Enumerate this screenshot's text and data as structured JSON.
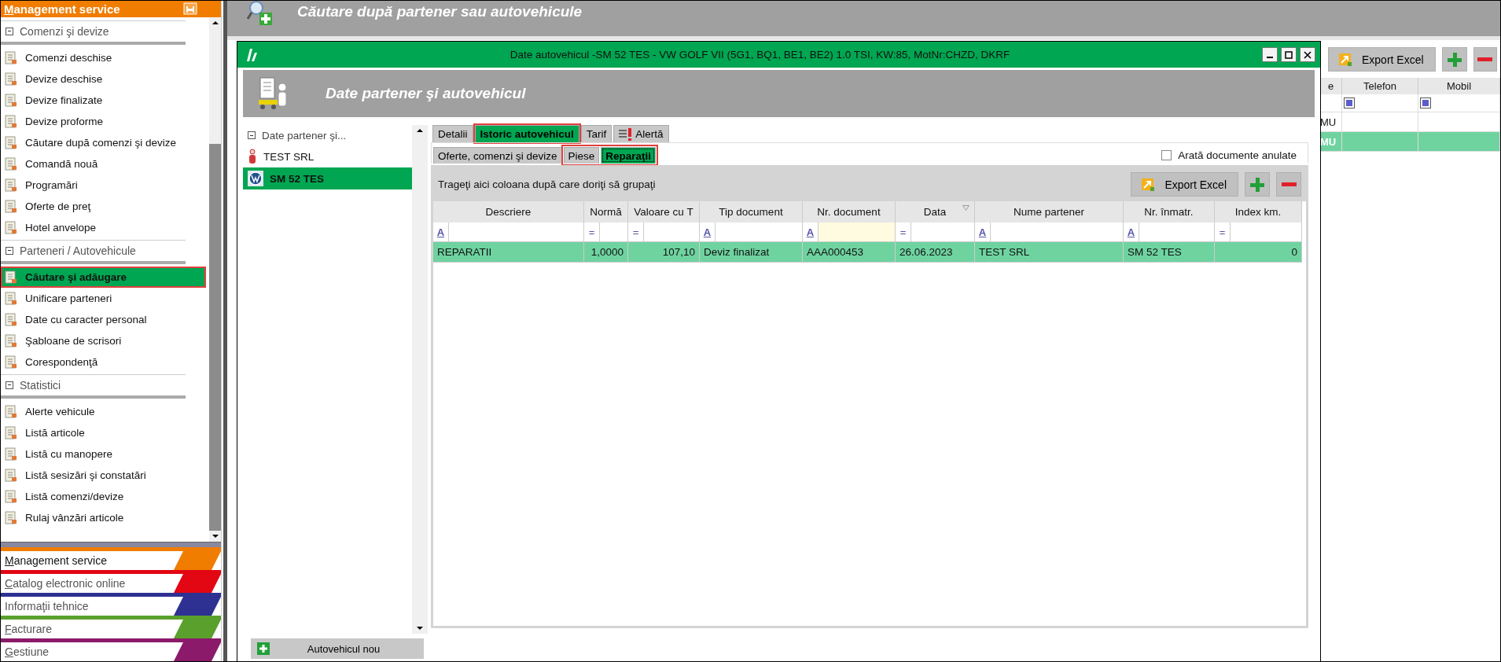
{
  "sidebar": {
    "header": {
      "label": "Management service",
      "underline_first": true
    },
    "sections": [
      {
        "title": "Comenzi şi devize",
        "expanded": true,
        "items": [
          {
            "label": "Comenzi deschise",
            "selected": false,
            "annotated": false
          },
          {
            "label": "Devize deschise",
            "selected": false,
            "annotated": false
          },
          {
            "label": "Devize finalizate",
            "selected": false,
            "annotated": false
          },
          {
            "label": "Devize proforme",
            "selected": false,
            "annotated": false
          },
          {
            "label": "Căutare după comenzi şi devize",
            "selected": false,
            "annotated": false
          },
          {
            "label": "Comandă nouă",
            "selected": false,
            "annotated": false
          },
          {
            "label": "Programări",
            "selected": false,
            "annotated": false
          },
          {
            "label": "Oferte de preţ",
            "selected": false,
            "annotated": false
          },
          {
            "label": "Hotel anvelope",
            "selected": false,
            "annotated": false
          }
        ]
      },
      {
        "title": "Parteneri / Autovehicule",
        "expanded": true,
        "items": [
          {
            "label": "Căutare şi adăugare",
            "selected": true,
            "annotated": true
          },
          {
            "label": "Unificare parteneri",
            "selected": false,
            "annotated": false
          },
          {
            "label": "Date cu caracter personal",
            "selected": false,
            "annotated": false
          },
          {
            "label": "Şabloane de scrisori",
            "selected": false,
            "annotated": false
          },
          {
            "label": "Corespondenţă",
            "selected": false,
            "annotated": false
          }
        ]
      },
      {
        "title": "Statistici",
        "expanded": true,
        "items": [
          {
            "label": "Alerte vehicule",
            "selected": false,
            "annotated": false
          },
          {
            "label": "Listă articole",
            "selected": false,
            "annotated": false
          },
          {
            "label": "Listă cu manopere",
            "selected": false,
            "annotated": false
          },
          {
            "label": "Listă sesizări şi constatări",
            "selected": false,
            "annotated": false
          },
          {
            "label": "Listă comenzi/devize",
            "selected": false,
            "annotated": false
          },
          {
            "label": "Rulaj vânzări articole",
            "selected": false,
            "annotated": false
          }
        ]
      }
    ]
  },
  "modules": [
    {
      "label": "Management service",
      "color": "#f07d00",
      "selected": true,
      "underline_first": true
    },
    {
      "label": "Catalog electronic online",
      "color": "#e30613",
      "selected": false,
      "underline_first": true
    },
    {
      "label": "Informaţii tehnice",
      "color": "#2e3192",
      "selected": false,
      "underline_first": false
    },
    {
      "label": "Facturare",
      "color": "#5aa02c",
      "selected": false,
      "underline_first": true
    },
    {
      "label": "Gestiune",
      "color": "#8b1a6b",
      "selected": false,
      "underline_first": true
    }
  ],
  "page": {
    "title": "Căutare după partener sau autovehicule"
  },
  "background_grid": {
    "export_label": "Export Excel",
    "columns": [
      {
        "label": "e",
        "kind": "text"
      },
      {
        "label": "Telefon",
        "kind": "flag"
      },
      {
        "label": "Mobil",
        "kind": "flag"
      }
    ],
    "rows": [
      {
        "first": "MU",
        "selected": false
      },
      {
        "first": "MU",
        "selected": true
      }
    ]
  },
  "dialog": {
    "title": "Date autovehicul -SM 52 TES - VW GOLF VII (5G1, BQ1, BE1, BE2) 1.0 TSI, KW:85, MotNr:CHZD, DKRF",
    "header": "Date partener şi autovehicul",
    "tree": {
      "label": "Date partener şi...",
      "expanded": true,
      "children": [
        {
          "label": "TEST SRL",
          "kind": "partner",
          "selected": false
        },
        {
          "label": "SM 52 TES",
          "kind": "vehicle",
          "selected": true
        }
      ]
    },
    "new_vehicle_button": "Autovehicul nou",
    "tabs": [
      {
        "label": "Detalii",
        "kind": "text",
        "selected": false,
        "annotated": false
      },
      {
        "label": "Istoric autovehicul",
        "kind": "text",
        "selected": true,
        "annotated": true
      },
      {
        "label": "Tarif",
        "kind": "text",
        "selected": false,
        "annotated": false
      },
      {
        "label": "Alertă",
        "kind": "alert",
        "selected": false,
        "annotated": false
      }
    ],
    "subtabs": [
      {
        "label": "Oferte, comenzi şi devize",
        "selected": false,
        "annotated": false
      },
      {
        "label": "Piese",
        "selected": false,
        "annotated": true
      },
      {
        "label": "Reparaţii",
        "selected": true,
        "annotated": true
      }
    ],
    "show_cancelled": {
      "label": "Arată documente anulate",
      "checked": false
    },
    "grid": {
      "group_hint": "Trageţi aici coloana după care doriţi să grupaţi",
      "export_label": "Export Excel",
      "columns": [
        {
          "label": "Descriere",
          "filter": "A",
          "numeric": false,
          "focused": false,
          "sorted": false
        },
        {
          "label": "Normă",
          "filter": "=",
          "numeric": true,
          "focused": false,
          "sorted": false
        },
        {
          "label": "Valoare cu T",
          "filter": "=",
          "numeric": true,
          "focused": false,
          "sorted": false
        },
        {
          "label": "Tip document",
          "filter": "A",
          "numeric": false,
          "focused": false,
          "sorted": false
        },
        {
          "label": "Nr. document",
          "filter": "A",
          "numeric": false,
          "focused": true,
          "sorted": false
        },
        {
          "label": "Data",
          "filter": "=",
          "numeric": false,
          "focused": false,
          "sorted": true
        },
        {
          "label": "Nume partener",
          "filter": "A",
          "numeric": false,
          "focused": false,
          "sorted": false
        },
        {
          "label": "Nr. înmatr.",
          "filter": "A",
          "numeric": false,
          "focused": false,
          "sorted": false
        },
        {
          "label": "Index km.",
          "filter": "=",
          "numeric": true,
          "focused": false,
          "sorted": false
        }
      ],
      "rows": [
        {
          "selected": true,
          "cells": [
            "REPARATII",
            "1,0000",
            "107,10",
            "Deviz finalizat",
            "AAA000453",
            "26.06.2023",
            "TEST SRL",
            "SM 52 TES",
            "0"
          ]
        }
      ]
    }
  }
}
